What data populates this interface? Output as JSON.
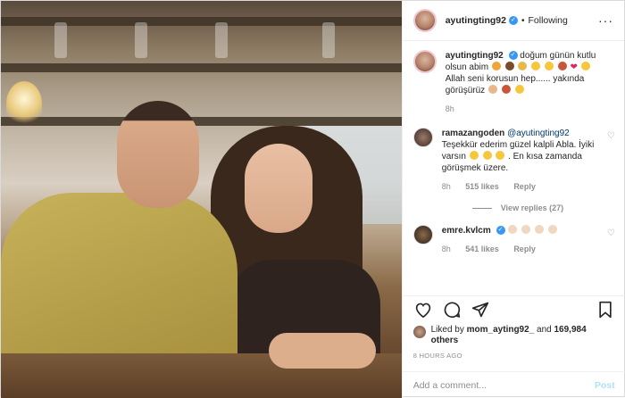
{
  "header": {
    "username": "ayutingting92",
    "follow_label": "Following",
    "separator": "•"
  },
  "caption": {
    "username": "ayutingting92",
    "text_part1": "doğum günün kutlu olsun abim",
    "text_part2": "Allah seni korusun hep...... yakında görüşürüz",
    "time": "8h"
  },
  "comments": [
    {
      "username": "ramazangoden",
      "mention": "@ayutingting92",
      "text_part1": "Teşekkür ederim güzel kalpli Abla. İyiki varsın",
      "text_part2": ". En kısa zamanda görüşmek üzere.",
      "time": "8h",
      "likes": "515 likes",
      "reply": "Reply",
      "view_replies": "View replies (27)"
    },
    {
      "username": "emre.kvlcm",
      "text": "",
      "time": "8h",
      "likes": "541 likes",
      "reply": "Reply"
    }
  ],
  "likes": {
    "liked_by": "Liked by",
    "user": "mom_ayting92_",
    "and": "and",
    "others": "169,984 others"
  },
  "time_ago": "8 HOURS AGO",
  "add_comment": {
    "placeholder": "Add a comment...",
    "post_label": "Post"
  },
  "colors": {
    "link": "#00376b",
    "verified": "#3897f0",
    "post_disabled": "#b2dffc"
  },
  "icons": [
    "heart-icon",
    "comment-icon",
    "share-icon",
    "bookmark-icon",
    "more-icon",
    "verified-icon"
  ]
}
